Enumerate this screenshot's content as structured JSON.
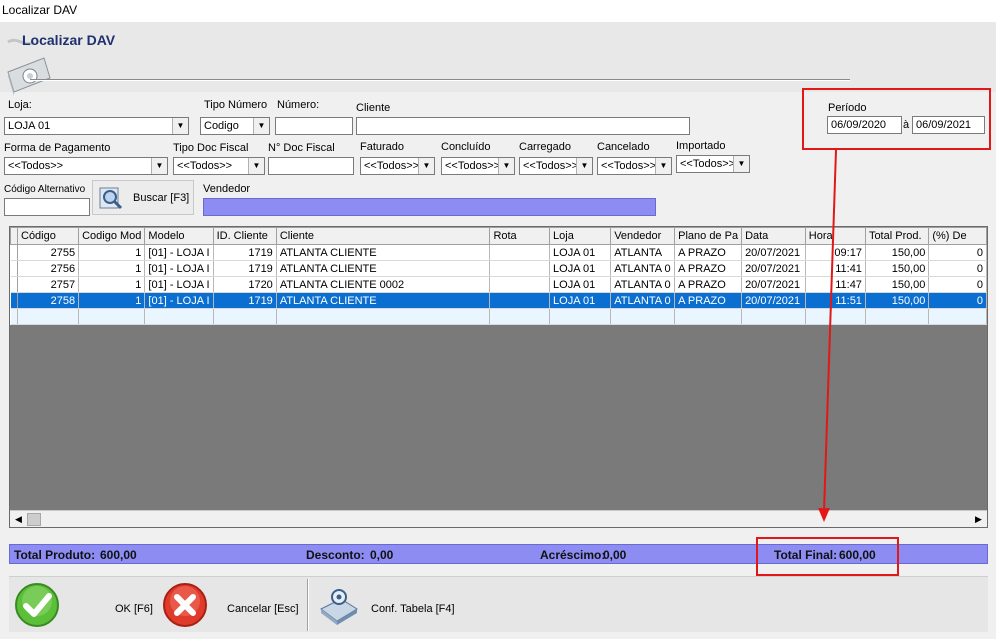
{
  "window": {
    "title": "Localizar DAV"
  },
  "header": {
    "title": "Localizar DAV"
  },
  "filters": {
    "loja_label": "Loja:",
    "loja_value": "LOJA 01",
    "tipo_numero_label": "Tipo Número",
    "tipo_numero_value": "Codigo",
    "numero_label": "Número:",
    "numero_value": "",
    "cliente_label": "Cliente",
    "cliente_value": "",
    "periodo_label": "Período",
    "periodo_from": "06/09/2020",
    "periodo_sep": "à",
    "periodo_to": "06/09/2021",
    "forma_pagamento_label": "Forma de Pagamento",
    "forma_pagamento_value": "<<Todos>>",
    "tipo_doc_fiscal_label": "Tipo Doc Fiscal",
    "tipo_doc_fiscal_value": "<<Todos>>",
    "n_doc_fiscal_label": "N° Doc Fiscal",
    "n_doc_fiscal_value": "",
    "faturado_label": "Faturado",
    "faturado_value": "<<Todos>>",
    "concluido_label": "Concluído",
    "concluido_value": "<<Todos>>",
    "carregado_label": "Carregado",
    "carregado_value": "<<Todos>>",
    "cancelado_label": "Cancelado",
    "cancelado_value": "<<Todos>>",
    "importado_label": "Importado",
    "importado_value": "<<Todos>>",
    "codigo_alternativo_label": "Código Alternativo",
    "codigo_alternativo_value": "",
    "buscar_label": "Buscar [F3]",
    "vendedor_label": "Vendedor",
    "vendedor_value": ""
  },
  "grid": {
    "columns": [
      "Código",
      "Codigo Mod",
      "Modelo",
      "ID. Cliente",
      "Cliente",
      "Rota",
      "Loja",
      "Vendedor",
      "Plano de Pa",
      "Data",
      "Hora",
      "Total Prod.",
      "(%) De"
    ],
    "rows": [
      [
        "2755",
        "1",
        "[01] - LOJA I",
        "1719",
        "ATLANTA CLIENTE",
        "",
        "LOJA 01",
        "ATLANTA",
        "A PRAZO",
        "20/07/2021",
        "09:17",
        "150,00",
        "0"
      ],
      [
        "2756",
        "1",
        "[01] - LOJA I",
        "1719",
        "ATLANTA CLIENTE",
        "",
        "LOJA 01",
        "ATLANTA 0",
        "A PRAZO",
        "20/07/2021",
        "11:41",
        "150,00",
        "0"
      ],
      [
        "2757",
        "1",
        "[01] - LOJA I",
        "1720",
        "ATLANTA CLIENTE 0002",
        "",
        "LOJA 01",
        "ATLANTA 0",
        "A PRAZO",
        "20/07/2021",
        "11:47",
        "150,00",
        "0"
      ],
      [
        "2758",
        "1",
        "[01] - LOJA I",
        "1719",
        "ATLANTA CLIENTE",
        "",
        "LOJA 01",
        "ATLANTA 0",
        "A PRAZO",
        "20/07/2021",
        "11:51",
        "150,00",
        "0"
      ]
    ],
    "selected_row": 3
  },
  "totals": {
    "total_produto_label": "Total Produto:",
    "total_produto_value": "600,00",
    "desconto_label": "Desconto:",
    "desconto_value": "0,00",
    "acrescimo_label": "Acréscimo:",
    "acrescimo_value": "0,00",
    "total_final_label": "Total Final:",
    "total_final_value": "600,00"
  },
  "buttons": {
    "ok_label": "OK [F6]",
    "cancelar_label": "Cancelar [Esc]",
    "conf_tabela_label": "Conf. Tabela [F4]"
  },
  "colors": {
    "accent": "#8c8cf2",
    "selection": "#0a6fd1",
    "annotation": "#e21818"
  }
}
